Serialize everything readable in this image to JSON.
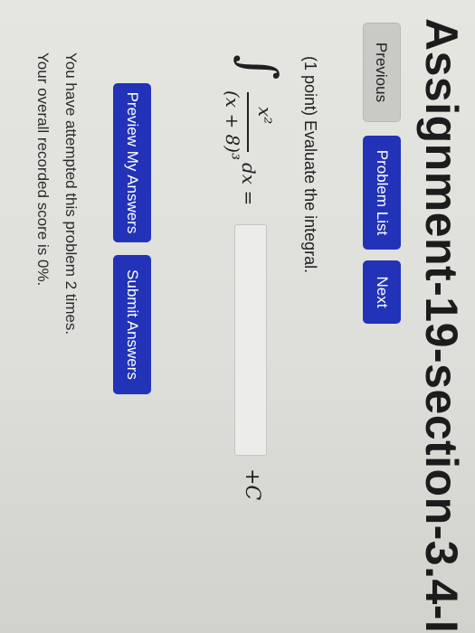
{
  "assignment": {
    "title": "Assignment-19-section-3.4-I"
  },
  "nav": {
    "previous_label": "Previous",
    "problem_list_label": "Problem List",
    "next_label": "Next"
  },
  "problem": {
    "prompt": "(1 point) Evaluate the integral.",
    "integral_sign": "∫",
    "numerator": "x²",
    "denominator": "(x + 8)³",
    "differential": "dx =",
    "constant": "+C",
    "answer_value": ""
  },
  "actions": {
    "preview_label": "Preview My Answers",
    "submit_label": "Submit Answers"
  },
  "status": {
    "attempts": "You have attempted this problem 2 times.",
    "score": "Your overall recorded score is 0%."
  },
  "colors": {
    "primary_button": "#2233b8",
    "secondary_button": "#c9c9c5",
    "text": "#1f1f1f"
  }
}
